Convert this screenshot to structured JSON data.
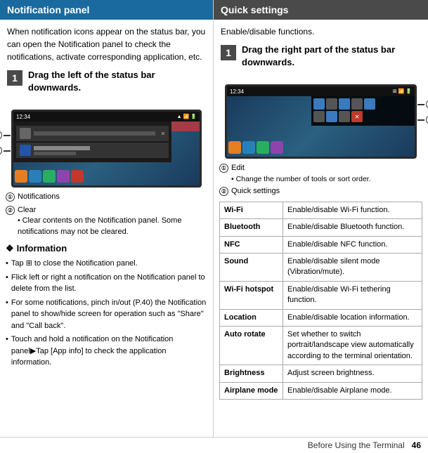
{
  "left": {
    "header": "Notification panel",
    "intro": "When notification icons appear on the status bar, you can open the Notification panel to check the notifications, activate corresponding application, etc.",
    "step1_num": "1",
    "step1_text": "Drag the left of the status bar downwards.",
    "annotation1_label": "Notifications",
    "annotation2_label": "Clear",
    "annotation2_sub": "Clear contents on the Notification panel. Some notifications may not be cleared.",
    "info_title": "Information",
    "info_bullets": [
      "Tap  to close the Notification panel.",
      "Flick left or right a notification on the Notification panel to delete from the list.",
      "For some notifications, pinch in/out (P.40) the Notification panel to show/hide screen for operation such as \"Share\" and \"Call back\".",
      "Touch and hold a notification on the Notification panel▶Tap [App info] to check the application information."
    ]
  },
  "right": {
    "header": "Quick settings",
    "intro": "Enable/disable functions.",
    "step1_num": "1",
    "step1_text": "Drag the right part of the status bar downwards.",
    "annotation1_label": "Edit",
    "annotation1_sub": "Change the number of tools or sort order.",
    "annotation2_label": "Quick settings",
    "table": [
      {
        "label": "Wi-Fi",
        "desc": "Enable/disable Wi-Fi function."
      },
      {
        "label": "Bluetooth",
        "desc": "Enable/disable Bluetooth function."
      },
      {
        "label": "NFC",
        "desc": "Enable/disable NFC function."
      },
      {
        "label": "Sound",
        "desc": "Enable/disable silent mode (Vibration/mute)."
      },
      {
        "label": "Wi-Fi hotspot",
        "desc": "Enable/disable Wi-Fi tethering function."
      },
      {
        "label": "Location",
        "desc": "Enable/disable location information."
      },
      {
        "label": "Auto rotate",
        "desc": "Set whether to switch portrait/landscape view automatically according to the terminal orientation."
      },
      {
        "label": "Brightness",
        "desc": "Adjust screen brightness."
      },
      {
        "label": "Airplane mode",
        "desc": "Enable/disable Airplane mode."
      }
    ]
  },
  "footer": {
    "text": "Before Using the Terminal",
    "page": "46"
  }
}
